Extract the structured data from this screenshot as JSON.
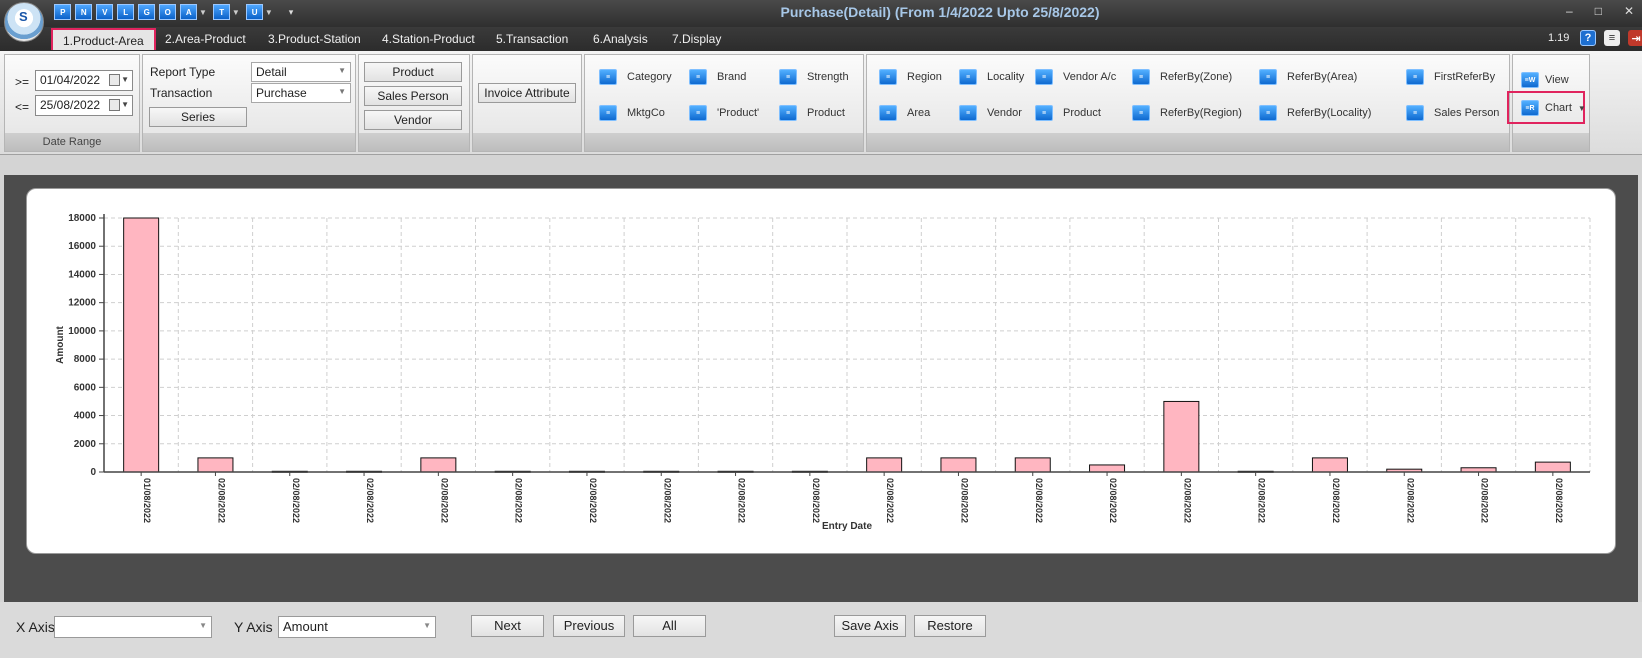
{
  "app": {
    "title": "Purchase(Detail) (From 1/4/2022 Upto 25/8/2022)",
    "logo_letter": "S",
    "quick_access": [
      {
        "label": "P",
        "dropdown": false
      },
      {
        "label": "N",
        "dropdown": false
      },
      {
        "label": "V",
        "dropdown": false
      },
      {
        "label": "L",
        "dropdown": false
      },
      {
        "label": "G",
        "dropdown": false
      },
      {
        "label": "O",
        "dropdown": false
      },
      {
        "label": "A",
        "dropdown": true
      },
      {
        "label": "T",
        "dropdown": true
      },
      {
        "label": "U",
        "dropdown": true
      }
    ],
    "version": "1.19",
    "window_controls": {
      "minimize": "–",
      "maximize": "□",
      "close": "✕"
    }
  },
  "tabs": [
    {
      "label": "1.Product-Area",
      "active": true
    },
    {
      "label": "2.Area-Product",
      "active": false
    },
    {
      "label": "3.Product-Station",
      "active": false
    },
    {
      "label": "4.Station-Product",
      "active": false
    },
    {
      "label": "5.Transaction",
      "active": false
    },
    {
      "label": "6.Analysis",
      "active": false
    },
    {
      "label": "7.Display",
      "active": false
    }
  ],
  "date_range": {
    "from_op": ">=",
    "from": "01/04/2022",
    "to_op": "<=",
    "to": "25/08/2022",
    "group_label": "Date Range"
  },
  "report": {
    "report_type_label": "Report Type",
    "report_type_value": "Detail",
    "transaction_label": "Transaction",
    "transaction_value": "Purchase",
    "series_button": "Series"
  },
  "party_buttons": [
    "Product",
    "Sales Person",
    "Vendor"
  ],
  "invoice_attribute": "Invoice Attribute",
  "group_items_1": [
    {
      "label": "Category",
      "icon": "category-icon"
    },
    {
      "label": "Brand",
      "icon": "brand-icon"
    },
    {
      "label": "Strength",
      "icon": "strength-icon"
    },
    {
      "label": "MktgCo",
      "icon": "mktgco-icon"
    },
    {
      "label": "'Product'",
      "icon": "product-group-icon"
    },
    {
      "label": "Product",
      "icon": "product-icon"
    }
  ],
  "group_items_2": [
    {
      "label": "Region",
      "icon": "region-icon"
    },
    {
      "label": "Locality",
      "icon": "locality-icon"
    },
    {
      "label": "Vendor A/c",
      "icon": "vendor-account-icon"
    },
    {
      "label": "ReferBy(Zone)",
      "icon": "referby-zone-icon"
    },
    {
      "label": "ReferBy(Area)",
      "icon": "referby-area-icon"
    },
    {
      "label": "FirstReferBy",
      "icon": "first-referby-icon"
    },
    {
      "label": "Area",
      "icon": "area-icon"
    },
    {
      "label": "Vendor",
      "icon": "vendor-icon"
    },
    {
      "label": "Product",
      "icon": "product-icon"
    },
    {
      "label": "ReferBy(Region)",
      "icon": "referby-region-icon"
    },
    {
      "label": "ReferBy(Locality)",
      "icon": "referby-locality-icon"
    },
    {
      "label": "Sales Person",
      "icon": "sales-person-icon"
    }
  ],
  "view_items": [
    {
      "label": "View",
      "icon": "view-icon"
    },
    {
      "label": "Chart",
      "icon": "chart-icon"
    }
  ],
  "chart_data": {
    "type": "bar",
    "xlabel": "Entry Date",
    "ylabel": "Amount",
    "ylim": [
      0,
      18000
    ],
    "yticks": [
      0,
      2000,
      4000,
      6000,
      8000,
      10000,
      12000,
      14000,
      16000,
      18000
    ],
    "grid": true,
    "bar_color": "#ffb6c1",
    "categories": [
      "01/08/2022",
      "02/08/2022",
      "02/08/2022",
      "02/08/2022",
      "02/08/2022",
      "02/08/2022",
      "02/08/2022",
      "02/08/2022",
      "02/08/2022",
      "02/08/2022",
      "02/08/2022",
      "02/08/2022",
      "02/08/2022",
      "02/08/2022",
      "02/08/2022",
      "02/08/2022",
      "02/08/2022",
      "02/08/2022",
      "02/08/2022",
      "02/08/2022"
    ],
    "values": [
      18000,
      1000,
      50,
      50,
      1000,
      50,
      50,
      50,
      50,
      50,
      1000,
      1000,
      1000,
      500,
      5000,
      50,
      1000,
      200,
      300,
      700
    ]
  },
  "bottom": {
    "x_axis_label": "X Axis",
    "x_axis_value": "",
    "y_axis_label": "Y Axis",
    "y_axis_value": "Amount",
    "next": "Next",
    "previous": "Previous",
    "all": "All",
    "save_axis": "Save Axis",
    "restore": "Restore"
  }
}
